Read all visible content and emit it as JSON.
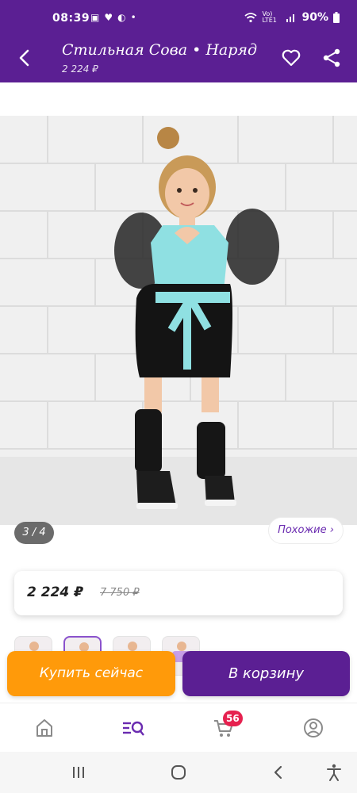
{
  "status_bar": {
    "time": "08:39",
    "left_icons": [
      "image-icon",
      "heart-icon",
      "nfc-icon",
      "dot-icon"
    ],
    "network_label": "Vo) LTE1",
    "battery": "90%"
  },
  "app_bar": {
    "title": "Стильная Сова • Наряд",
    "subtitle": "2 224 ₽",
    "back_icon": "back-arrow-icon",
    "favorite_icon": "heart-outline-icon",
    "share_icon": "share-icon"
  },
  "gallery": {
    "counter": "3 / 4",
    "similar_label": "Похожие ›"
  },
  "price": {
    "current": "2 224 ₽",
    "old": "7 750 ₽"
  },
  "actions": {
    "buy_now": "Купить сейчас",
    "add_to_cart": "В корзину"
  },
  "bottom_nav": {
    "items": [
      "home-icon",
      "catalog-search-icon",
      "cart-icon",
      "profile-icon"
    ],
    "cart_badge": "56"
  },
  "system_nav": [
    "recents-icon",
    "home-circle-icon",
    "back-icon",
    "accessibility-icon"
  ],
  "colors": {
    "brand_purple": "#5b1f93",
    "buy_orange": "#ff9a0a",
    "badge_red": "#e6214f"
  }
}
